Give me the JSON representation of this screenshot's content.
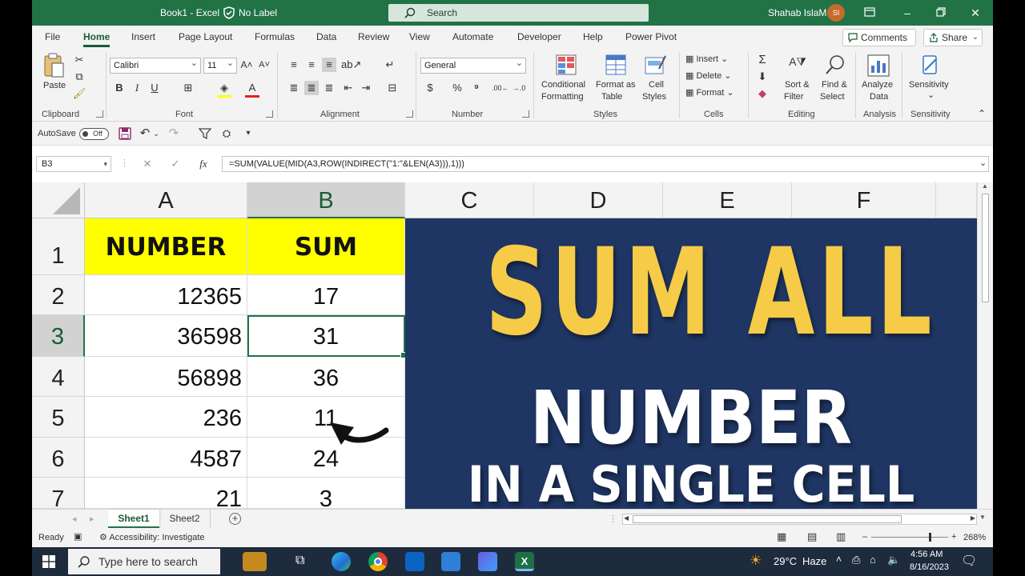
{
  "window": {
    "title": "Book1  -  Excel",
    "label": "No Label",
    "search": "Search",
    "user": "Shahab IslaM",
    "initials": "SI"
  },
  "menu": {
    "tabs": [
      "File",
      "Home",
      "Insert",
      "Page Layout",
      "Formulas",
      "Data",
      "Review",
      "View",
      "Automate",
      "Developer",
      "Help",
      "Power Pivot"
    ],
    "comments": "Comments",
    "share": "Share"
  },
  "ribbon": {
    "clipboard": {
      "paste": "Paste",
      "label": "Clipboard"
    },
    "font": {
      "name": "Calibri",
      "size": "11",
      "label": "Font"
    },
    "alignment": {
      "label": "Alignment"
    },
    "number": {
      "format": "General",
      "label": "Number"
    },
    "styles": {
      "cond1": "Conditional",
      "cond2": "Formatting",
      "fmt1": "Format as",
      "fmt2": "Table",
      "cell1": "Cell",
      "cell2": "Styles",
      "label": "Styles"
    },
    "cells": {
      "insert": "Insert",
      "delete": "Delete",
      "format": "Format",
      "label": "Cells"
    },
    "editing": {
      "sort1": "Sort &",
      "sort2": "Filter",
      "find1": "Find &",
      "find2": "Select",
      "label": "Editing"
    },
    "analysis": {
      "analyze1": "Analyze",
      "analyze2": "Data",
      "label": "Analysis"
    },
    "sensitivity": {
      "btn": "Sensitivity",
      "label": "Sensitivity"
    }
  },
  "qat": {
    "autosave": "AutoSave",
    "toggle": "Off"
  },
  "formula_bar": {
    "name_box": "B3",
    "fx": "fx",
    "formula": "=SUM(VALUE(MID(A3,ROW(INDIRECT(\"1:\"&LEN(A3))),1)))"
  },
  "grid": {
    "columns": [
      "A",
      "B",
      "C",
      "D",
      "E",
      "F"
    ],
    "rows": [
      "1",
      "2",
      "3",
      "4",
      "5",
      "6",
      "7"
    ],
    "header": {
      "a": "NUMBER",
      "b": "SUM"
    },
    "data": [
      {
        "a": "12365",
        "b": "17"
      },
      {
        "a": "36598",
        "b": "31"
      },
      {
        "a": "56898",
        "b": "36"
      },
      {
        "a": "236",
        "b": "11"
      },
      {
        "a": "4587",
        "b": "24"
      },
      {
        "a": "21",
        "b": "3"
      }
    ],
    "active_cell": "B3",
    "header_fill": "#ffff00"
  },
  "banner": {
    "line1": "SUM ALL",
    "line2": "NUMBER",
    "line3": "IN A SINGLE CELL",
    "bg": "#1f3664",
    "accent": "#f6cb47"
  },
  "sheets": [
    "Sheet1",
    "Sheet2"
  ],
  "status": {
    "ready": "Ready",
    "accessibility": "Accessibility: Investigate",
    "zoom": "268%"
  },
  "taskbar": {
    "search": "Type here to search",
    "weather_temp": "29°C",
    "weather_text": "Haze",
    "time": "4:56 AM",
    "date": "8/16/2023"
  },
  "colors": {
    "excel_green": "#217346",
    "taskbar": "#1e2b3d"
  }
}
